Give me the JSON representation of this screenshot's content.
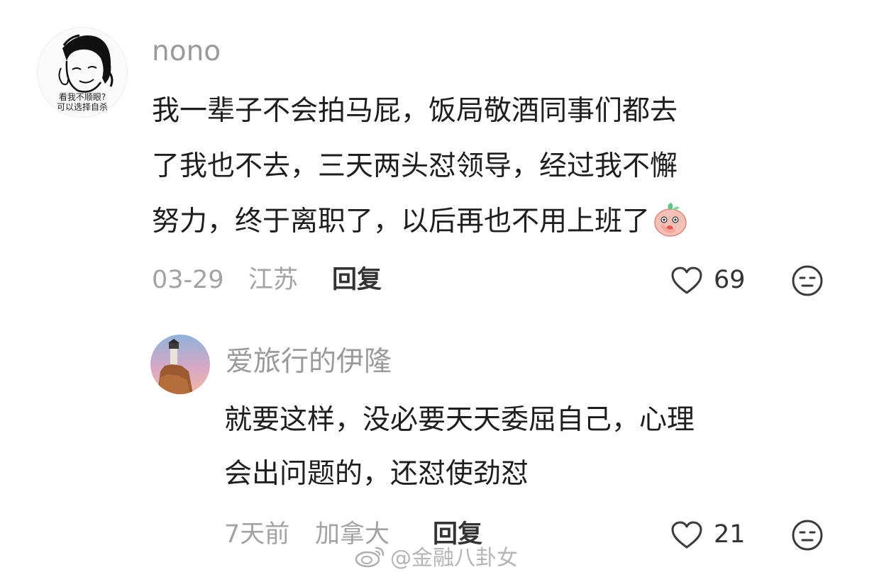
{
  "comment": {
    "avatar": {
      "icon": "doodle-avatar",
      "caption_line1": "看我不顺眼?",
      "caption_line2": "可以选择自杀"
    },
    "username": "nono",
    "content_lines": [
      "我一辈子不会拍马屁，饭局敬酒同事们都去",
      "了我也不去，三天两头怼领导，经过我不懈",
      "努力，终于离职了，以后再也不用上班了"
    ],
    "emoji": "peach-face-emoji",
    "date": "03-29",
    "location": "江苏",
    "reply_label": "回复",
    "like_count": "69"
  },
  "reply": {
    "avatar": {
      "icon": "lighthouse-photo-avatar"
    },
    "username": "爱旅行的伊隆",
    "content_lines": [
      "就要这样，没必要天天委屈自己，心理",
      "会出问题的，还怼使劲怼"
    ],
    "date": "7天前",
    "location": "加拿大",
    "reply_label": "回复",
    "like_count": "21"
  },
  "watermark": {
    "icon": "weibo-logo-icon",
    "text": "@金融八卦女"
  },
  "colors": {
    "username": "#9a9a9a",
    "meta": "#a3a3a3",
    "body": "#1e1e1e",
    "icon": "#3a3a3a"
  }
}
